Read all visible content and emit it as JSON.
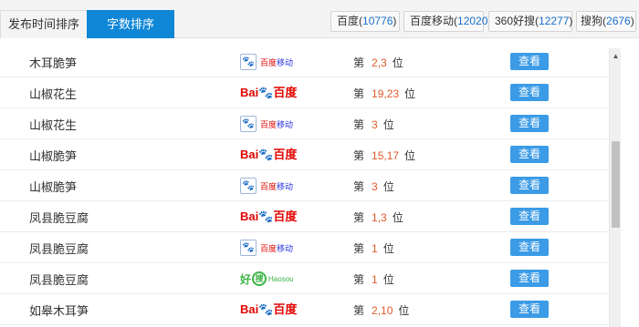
{
  "tabs": [
    {
      "label": "发布时间排序",
      "active": false
    },
    {
      "label": "字数排序",
      "active": true
    }
  ],
  "engine_counts": [
    {
      "name": "百度",
      "count": "10776"
    },
    {
      "name": "百度移动",
      "count": "12020"
    },
    {
      "name": "360好搜",
      "count": "12277"
    },
    {
      "name": "搜狗",
      "count": "2676"
    }
  ],
  "logos": {
    "baidu": {
      "bai": "Bai",
      "paw": "🐾",
      "du": "百度"
    },
    "baidu_mobile": {
      "icon": "🐾",
      "main": "百度",
      "sub": "移动"
    },
    "haosou": {
      "hao": "好",
      "sou": "搜",
      "sub": "Haosou"
    }
  },
  "rank_prefix": "第",
  "rank_suffix": "位",
  "view_label": "查看",
  "rows": [
    {
      "keyword": "木耳脆笋",
      "engine": "baidu_mobile",
      "rank": "2,3"
    },
    {
      "keyword": "山椒花生",
      "engine": "baidu",
      "rank": "19,23"
    },
    {
      "keyword": "山椒花生",
      "engine": "baidu_mobile",
      "rank": "3"
    },
    {
      "keyword": "山椒脆笋",
      "engine": "baidu",
      "rank": "15,17"
    },
    {
      "keyword": "山椒脆笋",
      "engine": "baidu_mobile",
      "rank": "3"
    },
    {
      "keyword": "凤县脆豆腐",
      "engine": "baidu",
      "rank": "1,3"
    },
    {
      "keyword": "凤县脆豆腐",
      "engine": "baidu_mobile",
      "rank": "1"
    },
    {
      "keyword": "凤县脆豆腐",
      "engine": "haosou",
      "rank": "1"
    },
    {
      "keyword": "如皋木耳笋",
      "engine": "baidu",
      "rank": "2,10"
    }
  ],
  "scrollbar": {
    "up_arrow": "▲"
  }
}
